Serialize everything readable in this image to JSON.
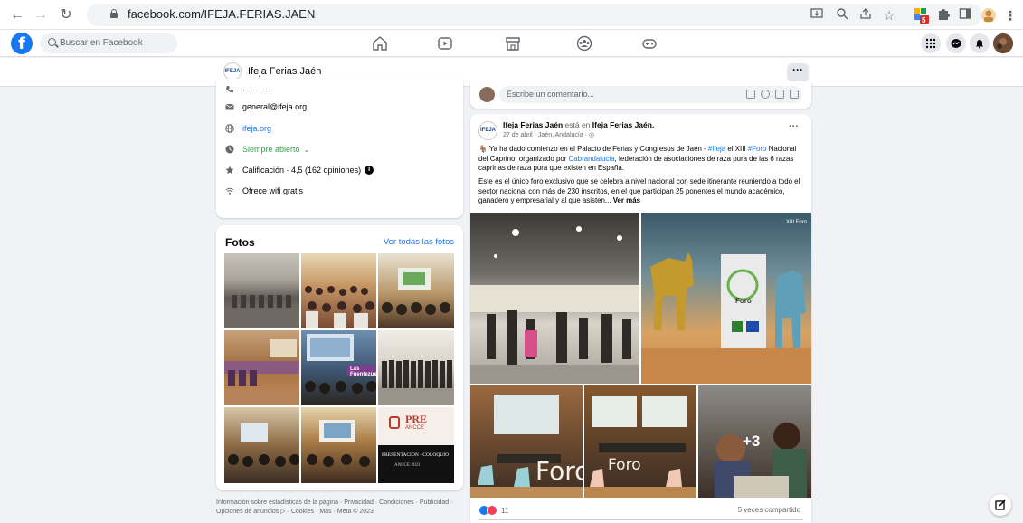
{
  "browser": {
    "url": "facebook.com/IFEJA.FERIAS.JAEN",
    "extension_badge": "5"
  },
  "fb": {
    "search_placeholder": "Buscar en Facebook",
    "logo_letter": "f"
  },
  "page": {
    "name": "Ifeja Ferias Jaén",
    "logo_text": "IFEJA",
    "more_label": "···"
  },
  "info": {
    "phone": "··· ·· ·· ··",
    "email": "general@ifeja.org",
    "website": "ifeja.org",
    "hours": "Siempre abierto",
    "rating": "Calificación · 4,5 (162 opiniones)",
    "wifi": "Ofrece wifi gratis"
  },
  "fotos": {
    "title": "Fotos",
    "see_all": "Ver todas las fotos"
  },
  "footer": {
    "line1": "Información sobre estadísticas de la página · Privacidad · Condiciones · Publicidad ·",
    "line2": "Opciones de anuncios ▷ · Cookies · Más · Meta © 2023"
  },
  "comment": {
    "placeholder": "Escribe un comentario..."
  },
  "post": {
    "author": "Ifeja Ferias Jaén",
    "is_in": "está en",
    "location": "Ifeja Ferias Jaén.",
    "meta": "27 de abril · Jaén, Andalucía ·",
    "more": "···",
    "text_p1_a": "Ya ha dado comienzo en el Palacio de Ferias y Congresos de Jaén -",
    "hashtag_ifeja": "#Ifeja",
    "text_p1_b": "el XIII",
    "hashtag_foro": "#Foro",
    "text_p1_c": "Nacional del Caprino, organizado por",
    "mention": "Cabrandalucia",
    "text_p1_d": ", federación de asociaciones de raza pura de las 6 razas caprinas de raza pura que existen en España.",
    "text_p2": "Este es el único foro exclusivo que se celebra a nivel nacional con sede itinerante reuniendo a todo el sector nacional con más de 230 inscritos, en el que participan 25 ponentes el mundo académico, ganadero y empresarial y al que asisten...",
    "see_more": "Ver más",
    "photo_more": "+3",
    "reactions_count": "11",
    "shares": "5 veces compartido"
  },
  "photo_texts": {
    "foro": "Foro",
    "foro_small": "Foro",
    "xiii": "XIII Foro",
    "pre": "PRE",
    "ancce": "ANCCE",
    "presentacion": "PRESENTACIÓN · COLOQUIO",
    "ancce_year": "ANCCE·2021",
    "las_fuentezuelas": "Las Fuentezuelas"
  },
  "colors": {
    "fb_blue": "#1877f2",
    "bg": "#f0f2f5"
  }
}
